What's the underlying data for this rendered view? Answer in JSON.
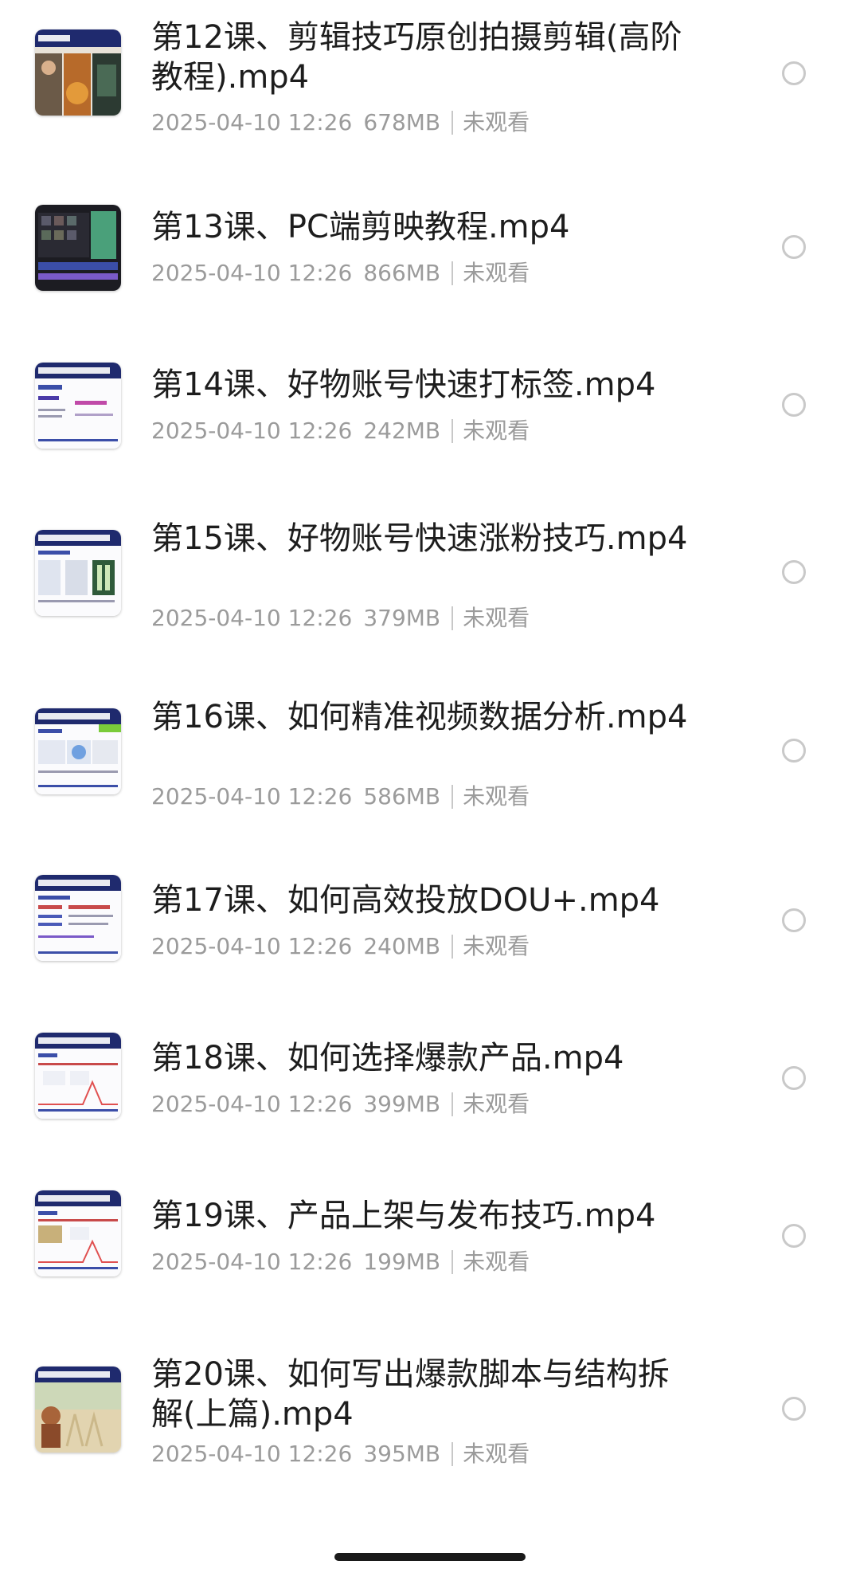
{
  "files": [
    {
      "title": "第12课、剪辑技巧原创拍摄剪辑(高阶教程).mp4",
      "date": "2025-04-10 12:26",
      "size": "678MB",
      "status": "未观看",
      "thumb": "photo-food"
    },
    {
      "title": "第13课、PC端剪映教程.mp4",
      "date": "2025-04-10 12:26",
      "size": "866MB",
      "status": "未观看",
      "thumb": "editor-dark"
    },
    {
      "title": "第14课、好物账号快速打标签.mp4",
      "date": "2025-04-10 12:26",
      "size": "242MB",
      "status": "未观看",
      "thumb": "slide"
    },
    {
      "title": "第15课、好物账号快速涨粉技巧.mp4",
      "date": "2025-04-10 12:26",
      "size": "379MB",
      "status": "未观看",
      "thumb": "slide"
    },
    {
      "title": "第16课、如何精准视频数据分析.mp4",
      "date": "2025-04-10 12:26",
      "size": "586MB",
      "status": "未观看",
      "thumb": "slide"
    },
    {
      "title": "第17课、如何高效投放DOU+.mp4",
      "date": "2025-04-10 12:26",
      "size": "240MB",
      "status": "未观看",
      "thumb": "slide"
    },
    {
      "title": "第18课、如何选择爆款产品.mp4",
      "date": "2025-04-10 12:26",
      "size": "399MB",
      "status": "未观看",
      "thumb": "slide"
    },
    {
      "title": "第19课、产品上架与发布技巧.mp4",
      "date": "2025-04-10 12:26",
      "size": "199MB",
      "status": "未观看",
      "thumb": "slide"
    },
    {
      "title": "第20课、如何写出爆款脚本与结构拆解(上篇).mp4",
      "date": "2025-04-10 12:26",
      "size": "395MB",
      "status": "未观看",
      "thumb": "photo-field"
    }
  ],
  "colors": {
    "title": "#1d1d1d",
    "meta": "#9b9b9b",
    "radio_border": "#c9c9c9",
    "slide_header": "#1f2a6e"
  }
}
